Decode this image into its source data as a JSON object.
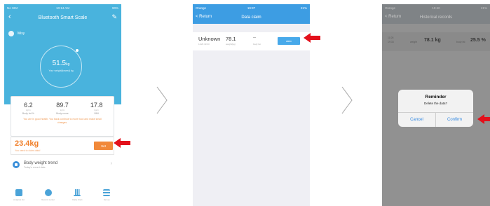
{
  "screen1": {
    "status": {
      "carrier": "No SIM",
      "time": "10:14 AM",
      "battery": "90%"
    },
    "title": "Bluetooth Smart Scale",
    "user": "Misy",
    "gauge": {
      "value": "51.5",
      "unit": "kg",
      "caption": "Your weight(lowest) kg"
    },
    "stats": [
      {
        "value": "6.2",
        "sub": "kg/m",
        "label": "Body fat %"
      },
      {
        "value": "89.7",
        "sub": "kg/m",
        "label": "Body score"
      },
      {
        "value": "17.8",
        "sub": "kg/m",
        "label": "BMI"
      }
    ],
    "tip": "You are in good health. You track continue to more food and make small changes.",
    "target": {
      "value": "23.4kg",
      "sub": "You need to claim data!",
      "button": "Set"
    },
    "trend": {
      "title": "Body weight trend",
      "sub": "Today's record data"
    },
    "tabs": [
      "Analysis list",
      "Record center",
      "Daily chart",
      "Set up"
    ]
  },
  "screen2": {
    "status": {
      "carrier": "Orange",
      "time": "19:37",
      "battery": "21%"
    },
    "back": "< Return",
    "title": "Data claim",
    "row": {
      "name": "Unknown",
      "time": "11/26 19:33",
      "weight": "78.1",
      "weight_label": "weight(kg)",
      "bodyfat": "--",
      "bodyfat_label": "body fat",
      "button": "claim"
    }
  },
  "screen3": {
    "status": {
      "carrier": "Orange",
      "time": "19:40",
      "battery": "21%"
    },
    "back": "< Return",
    "title": "Historical records",
    "row": {
      "date1": "11/26",
      "date2": "19:33",
      "weight_label": "weight",
      "weight": "78.1 kg",
      "bodyfat_label": "body fat",
      "bodyfat": "25.5 %"
    },
    "dialog": {
      "title": "Reminder",
      "message": "Delete the data?",
      "cancel": "Cancel",
      "confirm": "Confirm"
    }
  },
  "colors": {
    "primary": "#49b3dd",
    "accent_orange": "#f1893a",
    "arrow_red": "#e3101b",
    "dialog_blue": "#2f86e0"
  }
}
